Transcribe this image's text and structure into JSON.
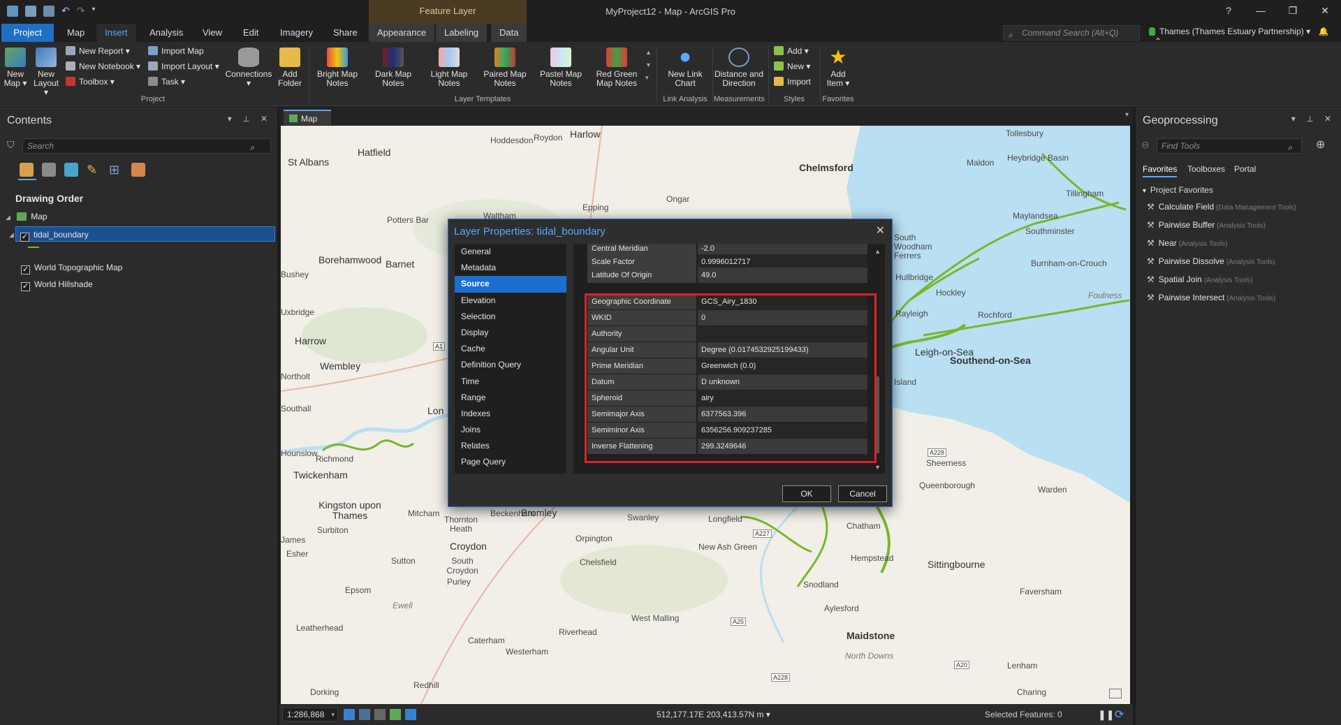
{
  "window": {
    "title": "MyProject12 - Map - ArcGIS Pro",
    "context_tab_group": "Feature Layer",
    "help": "?",
    "minimize": "—",
    "restore": "❐",
    "close": "✕"
  },
  "ribbon_tabs": [
    "Project",
    "Map",
    "Insert",
    "Analysis",
    "View",
    "Edit",
    "Imagery",
    "Share",
    "Appearance",
    "Labeling",
    "Data"
  ],
  "command_search": {
    "placeholder": "Command Search (Alt+Q)"
  },
  "account": {
    "label": "Thames (Thames Estuary Partnership)"
  },
  "ribbon": {
    "project_group": {
      "label": "Project",
      "new_map": "New Map",
      "new_layout": "New Layout",
      "new_report": "New Report",
      "new_notebook": "New Notebook",
      "toolbox": "Toolbox",
      "import_map": "Import Map",
      "import_layout": "Import Layout",
      "task": "Task",
      "connections": "Connections",
      "add_folder": "Add Folder"
    },
    "layer_templates": {
      "label": "Layer Templates",
      "items": [
        "Bright Map Notes",
        "Dark Map Notes",
        "Light Map Notes",
        "Paired Map Notes",
        "Pastel Map Notes",
        "Red Green Map Notes"
      ]
    },
    "link_analysis": {
      "label": "Link Analysis",
      "new_link_chart": "New Link Chart"
    },
    "measurements": {
      "label": "Measurements",
      "distance_direction": "Distance and Direction"
    },
    "styles": {
      "label": "Styles",
      "add": "Add",
      "new": "New",
      "import": "Import"
    },
    "favorites": {
      "label": "Favorites",
      "add_item": "Add Item"
    }
  },
  "contents": {
    "title": "Contents",
    "search_placeholder": "Search",
    "drawing_order": "Drawing Order",
    "tree": {
      "map": "Map",
      "layers": [
        "tidal_boundary",
        "World Topographic Map",
        "World Hillshade"
      ]
    }
  },
  "map_view": {
    "tab": "Map",
    "places": [
      "Hoddesdon",
      "Roydon",
      "Harlow",
      "Tollesbury",
      "St Albans",
      "Hatfield",
      "Chelmsford",
      "Heybridge Basin",
      "Maldon",
      "Tillingham",
      "Ongar",
      "Epping",
      "Waltham",
      "Potters Bar",
      "Maylandsea",
      "Southminster",
      "South Woodham Ferrers",
      "Burnham-on-Crouch",
      "Hullbridge",
      "Borehamwood",
      "Barnet",
      "Bushey",
      "Hockley",
      "Rochford",
      "Rayleigh",
      "Harrow",
      "Wembley",
      "Leigh-on-Sea",
      "Southend-on-Sea",
      "Canvey Island",
      "Northolt",
      "Southall",
      "Lon",
      "Hounslow",
      "Twickenham",
      "Richmond",
      "Sheerness",
      "Queenborough",
      "Warden",
      "Kingston upon Thames",
      "Mitcham",
      "Thornton Heath",
      "Beckenham",
      "Bromley",
      "Swanley",
      "Longfield",
      "Chatham",
      "Surbiton",
      "Croydon",
      "Orpington",
      "New Ash Green",
      "Esher",
      "Sutton",
      "South Croydon",
      "Purley",
      "Chelsfield",
      "Hempstead",
      "Sittingbourne",
      "Epsom",
      "Snodland",
      "Faversham",
      "Aylesford",
      "Leatherhead",
      "West Malling",
      "Riverhead",
      "Maidstone",
      "Caterham",
      "Westerham",
      "North Downs",
      "Lenham",
      "Dorking",
      "Redhill",
      "Charing",
      "Foulness",
      "James",
      "Ewell",
      "Uxbridge"
    ],
    "road_badges": [
      "A1",
      "A228",
      "A227",
      "A25",
      "A20",
      "A228"
    ],
    "scale": "1:286,868",
    "coordinates": "512,177.17E 203,413.57N m",
    "selected_features": "Selected Features: 0"
  },
  "dialog": {
    "title": "Layer Properties: tidal_boundary",
    "close": "✕",
    "nav": [
      "General",
      "Metadata",
      "Source",
      "Elevation",
      "Selection",
      "Display",
      "Cache",
      "Definition Query",
      "Time",
      "Range",
      "Indexes",
      "Joins",
      "Relates",
      "Page Query"
    ],
    "selected_nav": "Source",
    "rows": [
      {
        "k": "Central Meridian",
        "v": "-2.0"
      },
      {
        "k": "Scale Factor",
        "v": "0.9996012717"
      },
      {
        "k": "Latitude Of Origin",
        "v": "49.0"
      },
      {
        "k": "Geographic Coordinate System",
        "v": "GCS_Airy_1830"
      },
      {
        "k": "WKID",
        "v": "0"
      },
      {
        "k": "Authority",
        "v": ""
      },
      {
        "k": "Angular Unit",
        "v": "Degree (0.0174532925199433)"
      },
      {
        "k": "Prime Meridian",
        "v": "Greenwich (0.0)"
      },
      {
        "k": "Datum",
        "v": "D unknown"
      },
      {
        "k": "Spheroid",
        "v": "airy"
      },
      {
        "k": "Semimajor Axis",
        "v": "6377563.396"
      },
      {
        "k": "Semiminor Axis",
        "v": "6356256.909237285"
      },
      {
        "k": "Inverse Flattening",
        "v": "299.3249646"
      }
    ],
    "ok": "OK",
    "cancel": "Cancel"
  },
  "geoprocessing": {
    "title": "Geoprocessing",
    "search_placeholder": "Find Tools",
    "tabs": [
      "Favorites",
      "Toolboxes",
      "Portal"
    ],
    "section": "Project Favorites",
    "tools": [
      {
        "name": "Calculate Field",
        "box": "(Data Management Tools)"
      },
      {
        "name": "Pairwise Buffer",
        "box": "(Analysis Tools)"
      },
      {
        "name": "Near",
        "box": "(Analysis Tools)"
      },
      {
        "name": "Pairwise Dissolve",
        "box": "(Analysis Tools)"
      },
      {
        "name": "Spatial Join",
        "box": "(Analysis Tools)"
      },
      {
        "name": "Pairwise Intersect",
        "box": "(Analysis Tools)"
      }
    ]
  },
  "colors": {
    "accent": "#1a6fd0",
    "highlight": "#e0202a",
    "tidal": "#76b82a"
  }
}
